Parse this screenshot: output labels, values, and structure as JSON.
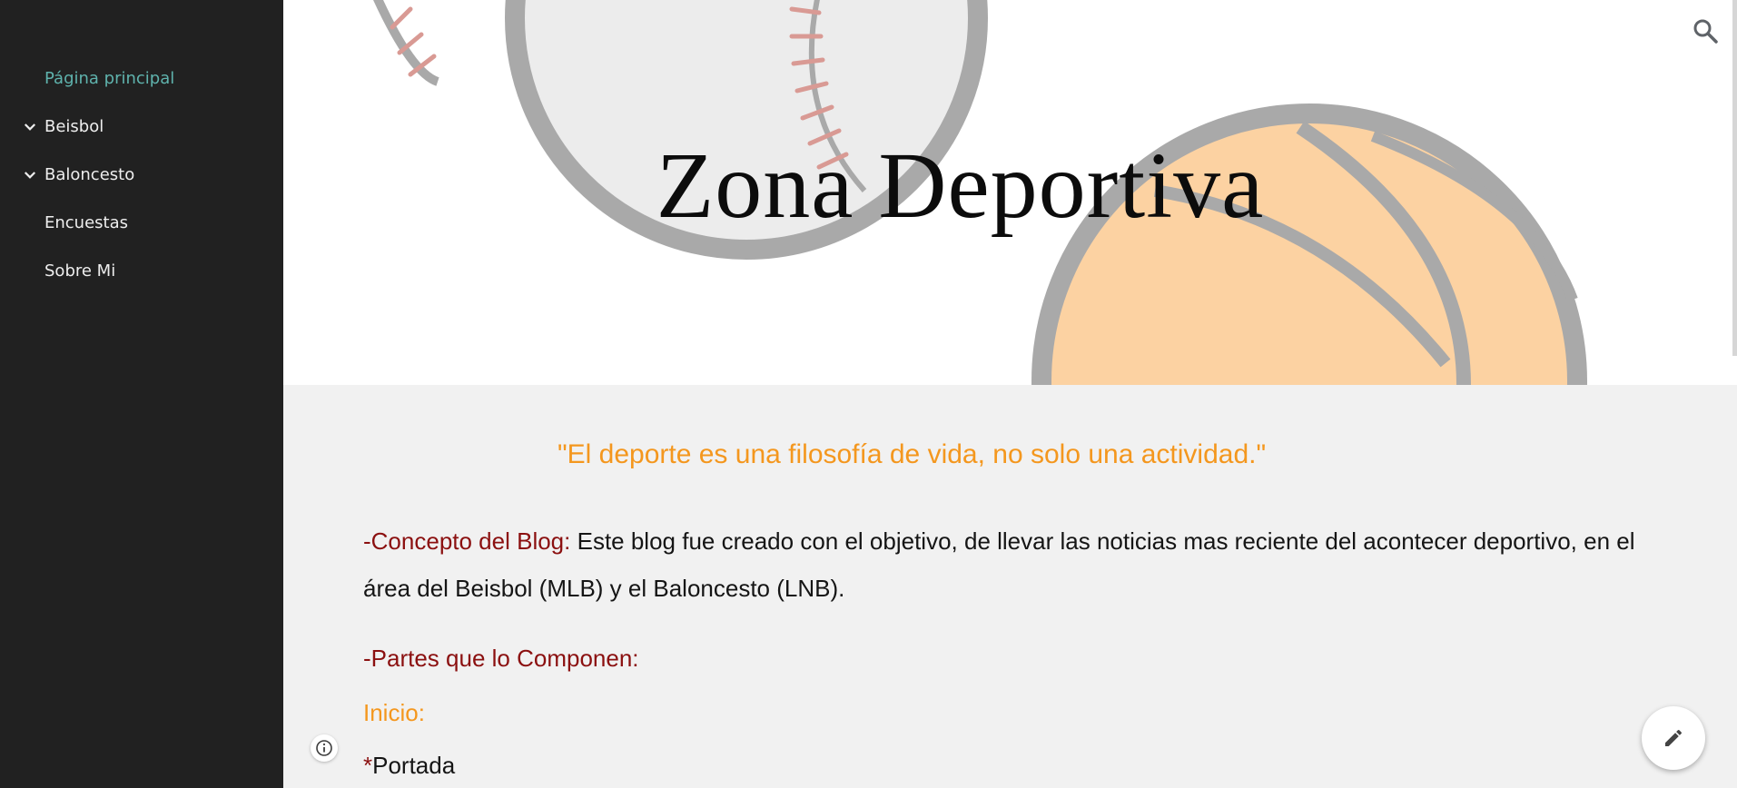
{
  "sidebar": {
    "items": [
      {
        "label": "Página principal",
        "active": true,
        "expandable": false
      },
      {
        "label": "Beisbol",
        "active": false,
        "expandable": true
      },
      {
        "label": "Baloncesto",
        "active": false,
        "expandable": true
      },
      {
        "label": "Encuestas",
        "active": false,
        "expandable": false
      },
      {
        "label": "Sobre Mi",
        "active": false,
        "expandable": false
      }
    ]
  },
  "header": {
    "title": "Zona Deportiva",
    "search_icon": "search-icon",
    "background_art": [
      "baseball",
      "basketball"
    ]
  },
  "content": {
    "quote": "\"El deporte es una filosofía de vida, no solo una actividad.\"",
    "concept_label": "-Concepto del Blog:",
    "concept_text": " Este blog fue creado con el objetivo, de llevar las noticias mas reciente del acontecer deportivo, en el área del Beisbol (MLB) y el Baloncesto (LNB).",
    "parts_label": "-Partes que lo Componen:",
    "inicio_label": "Inicio:",
    "asterisk": "*",
    "portada_label": "Portada"
  },
  "buttons": {
    "info_icon": "info-icon",
    "edit_icon": "pencil-icon"
  },
  "colors": {
    "sidebar_bg": "#212121",
    "active_link": "#5fb3ad",
    "accent_orange": "#f4971e",
    "accent_red": "#8b1010",
    "content_bg": "#f1f1f1"
  }
}
